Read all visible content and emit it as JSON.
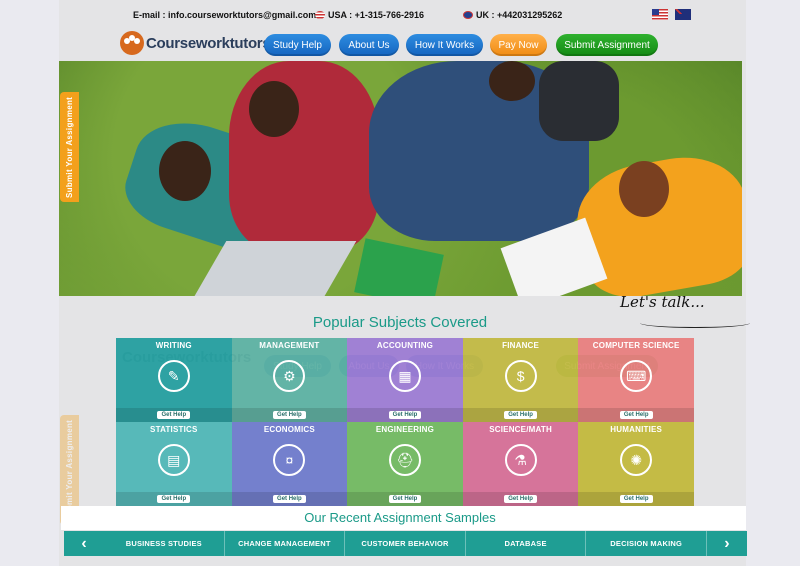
{
  "topbar": {
    "email": "E-mail : info.courseworktutors@gmail.com",
    "usa": "USA : +1-315-766-2916",
    "uk": "UK : +442031295262"
  },
  "brand": {
    "name": "Courseworktutors"
  },
  "nav": {
    "study_help": "Study Help",
    "about_us": "About Us",
    "how_it_works": "How It Works",
    "pay_now": "Pay Now",
    "submit_assignment": "Submit Assignment"
  },
  "side_tab": {
    "label": "Submit Your Assignment"
  },
  "chat": {
    "label": "Let's talk..."
  },
  "subjects": {
    "title": "Popular Subjects Covered",
    "cta": "Get Help",
    "items": [
      {
        "name": "Writing"
      },
      {
        "name": "Management"
      },
      {
        "name": "Accounting"
      },
      {
        "name": "Finance"
      },
      {
        "name": "Computer Science"
      },
      {
        "name": "Statistics"
      },
      {
        "name": "Economics"
      },
      {
        "name": "Engineering"
      },
      {
        "name": "Science/Math"
      },
      {
        "name": "Humanities"
      }
    ]
  },
  "samples": {
    "title": "Our Recent Assignment Samples",
    "items": [
      "BUSINESS STUDIES",
      "CHANGE MANAGEMENT",
      "CUSTOMER BEHAVIOR",
      "DATABASE",
      "DECISION MAKING"
    ]
  },
  "colors": {
    "accent": "#1a9a88",
    "nav_blue": "#1565c0",
    "pay_orange": "#f08b12",
    "submit_green": "#138a13"
  }
}
